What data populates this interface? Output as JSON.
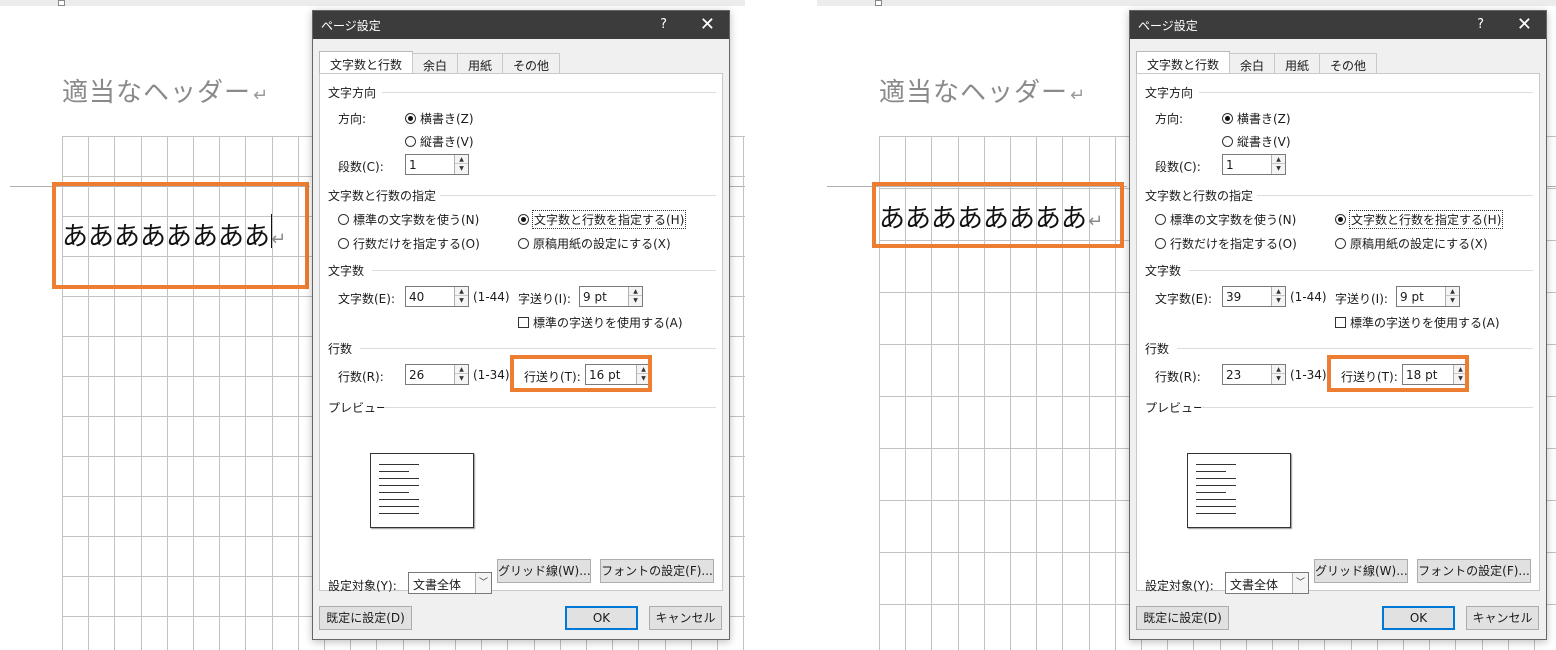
{
  "accent_color": "#ed7d31",
  "panels": [
    {
      "doc": {
        "header_text": "適当なヘッダー",
        "return_mark": "↵",
        "body_text": "ああああああああ"
      },
      "dialog": {
        "title": "ページ設定",
        "help": "?",
        "close": "✕",
        "tabs": [
          "文字数と行数",
          "余白",
          "用紙",
          "その他"
        ],
        "sections": {
          "direction": "文字方向",
          "grid": "文字数と行数の指定",
          "chars": "文字数",
          "lines": "行数",
          "preview": "プレビュー"
        },
        "direction_label": "方向:",
        "horizontal": "横書き(Z)",
        "vertical": "縦書き(V)",
        "columns_label": "段数(C):",
        "columns_value": "1",
        "grid_options": [
          "標準の文字数を使う(N)",
          "文字数と行数を指定する(H)",
          "行数だけを指定する(O)",
          "原稿用紙の設定にする(X)"
        ],
        "chars_label": "文字数(E):",
        "chars_value": "40",
        "chars_range": "(1-44)",
        "pitch_label": "字送り(I):",
        "pitch_value": "9 pt",
        "default_pitch": "標準の字送りを使用する(A)",
        "lines_label": "行数(R):",
        "lines_value": "26",
        "lines_range": "(1-34)",
        "line_pitch_label": "行送り(T):",
        "line_pitch_value": "16 pt",
        "apply_label": "設定対象(Y):",
        "apply_value": "文書全体",
        "grid_button": "グリッド線(W)...",
        "font_button": "フォントの設定(F)...",
        "default_button": "既定に設定(D)",
        "ok_button": "OK",
        "cancel_button": "キャンセル"
      }
    },
    {
      "doc": {
        "header_text": "適当なヘッダー",
        "return_mark": "↵",
        "body_text": "ああああああああ"
      },
      "dialog": {
        "title": "ページ設定",
        "help": "?",
        "close": "✕",
        "tabs": [
          "文字数と行数",
          "余白",
          "用紙",
          "その他"
        ],
        "sections": {
          "direction": "文字方向",
          "grid": "文字数と行数の指定",
          "chars": "文字数",
          "lines": "行数",
          "preview": "プレビュー"
        },
        "direction_label": "方向:",
        "horizontal": "横書き(Z)",
        "vertical": "縦書き(V)",
        "columns_label": "段数(C):",
        "columns_value": "1",
        "grid_options": [
          "標準の文字数を使う(N)",
          "文字数と行数を指定する(H)",
          "行数だけを指定する(O)",
          "原稿用紙の設定にする(X)"
        ],
        "chars_label": "文字数(E):",
        "chars_value": "39",
        "chars_range": "(1-44)",
        "pitch_label": "字送り(I):",
        "pitch_value": "9 pt",
        "default_pitch": "標準の字送りを使用する(A)",
        "lines_label": "行数(R):",
        "lines_value": "23",
        "lines_range": "(1-34)",
        "line_pitch_label": "行送り(T):",
        "line_pitch_value": "18 pt",
        "apply_label": "設定対象(Y):",
        "apply_value": "文書全体",
        "grid_button": "グリッド線(W)...",
        "font_button": "フォントの設定(F)...",
        "default_button": "既定に設定(D)",
        "ok_button": "OK",
        "cancel_button": "キャンセル"
      }
    }
  ]
}
